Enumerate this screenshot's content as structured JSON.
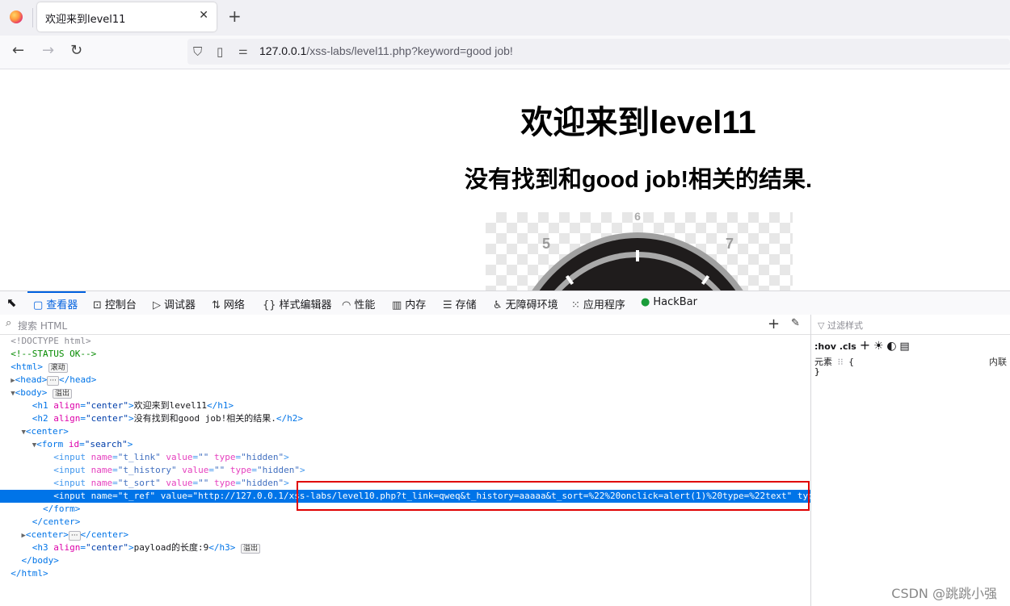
{
  "browser": {
    "tab_title": "欢迎来到level11",
    "url_host": "127.0.0.1",
    "url_rest": "/xss-labs/level11.php?keyword=good job!"
  },
  "page": {
    "h1": "欢迎来到level11",
    "h2": "没有找到和good job!相关的结果.",
    "clock_numbers": [
      "5",
      "6",
      "7"
    ]
  },
  "devtools": {
    "tabs": [
      "查看器",
      "控制台",
      "调试器",
      "网络",
      "样式编辑器",
      "性能",
      "内存",
      "存储",
      "无障碍环境",
      "应用程序",
      "HackBar"
    ],
    "search_placeholder": "搜索 HTML",
    "badge_scroll": "滚动",
    "badge_overflow": "溢出",
    "rules_filter": "过滤样式",
    "rules_hov": ":hov",
    "rules_cls": ".cls",
    "rules_element": "元素",
    "rules_inline": "内联",
    "markup": {
      "doctype": "<!DOCTYPE html>",
      "comment": "<!--STATUS OK-->",
      "h1_text": "欢迎来到level11",
      "h2_text": "没有找到和good job!相关的结果.",
      "t_ref_value": "http://127.0.0.1/xss-labs/level10.php?t_link=qweq&t_history=aaaaa&t_sort=%22%20onclick=alert(1)%20type=%22text",
      "h3_text": "payload的长度:9"
    }
  },
  "watermark": "CSDN @跳跳小强"
}
